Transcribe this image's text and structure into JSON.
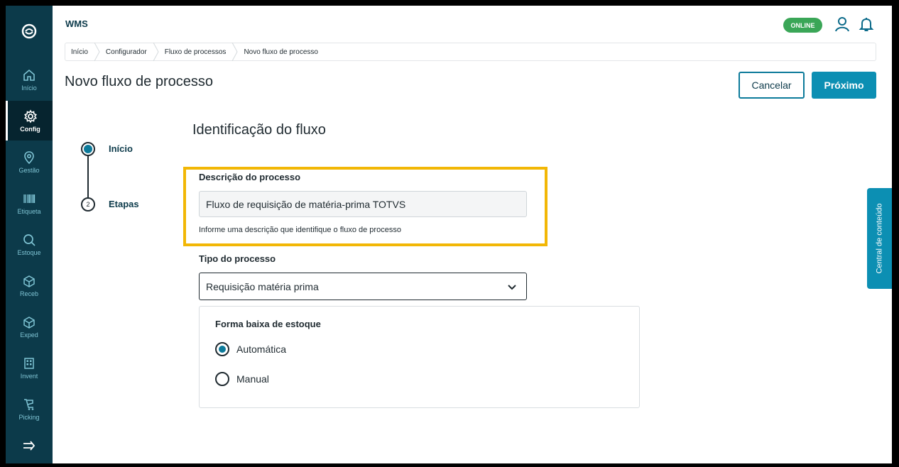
{
  "app": {
    "title": "WMS",
    "status": "ONLINE"
  },
  "colors": {
    "sidebar": "#0c3a4a",
    "accent": "#0c8fb3",
    "highlight": "#f2b705",
    "online": "#3aa657"
  },
  "sidebar": {
    "items": [
      {
        "label": "Início",
        "icon": "home-icon"
      },
      {
        "label": "Config",
        "icon": "gear-icon",
        "active": true
      },
      {
        "label": "Gestão",
        "icon": "location-icon"
      },
      {
        "label": "Etiqueta",
        "icon": "barcode-icon"
      },
      {
        "label": "Estoque",
        "icon": "search-icon"
      },
      {
        "label": "Receb",
        "icon": "box-icon"
      },
      {
        "label": "Exped",
        "icon": "box-icon"
      },
      {
        "label": "Invent",
        "icon": "building-icon"
      },
      {
        "label": "Picking",
        "icon": "cart-icon"
      }
    ],
    "collapse_icon": "expand-arrow-icon"
  },
  "breadcrumb": [
    "Início",
    "Configurador",
    "Fluxo de processos",
    "Novo fluxo de processo"
  ],
  "page": {
    "title": "Novo fluxo de processo",
    "cancel_label": "Cancelar",
    "next_label": "Próximo"
  },
  "stepper": {
    "steps": [
      {
        "label": "Início",
        "number": ""
      },
      {
        "label": "Etapas",
        "number": "2"
      }
    ]
  },
  "form": {
    "section_title": "Identificação do fluxo",
    "description": {
      "label": "Descrição do processo",
      "value": "Fluxo de requisição de matéria-prima TOTVS",
      "helper": "Informe uma descrição que identifique o fluxo de processo"
    },
    "type": {
      "label": "Tipo do processo",
      "value": "Requisição matéria prima"
    },
    "stock": {
      "title": "Forma baixa de estoque",
      "options": [
        {
          "label": "Automática",
          "selected": true
        },
        {
          "label": "Manual",
          "selected": false
        }
      ]
    }
  },
  "side_tab": {
    "label": "Central de conteúdo"
  }
}
